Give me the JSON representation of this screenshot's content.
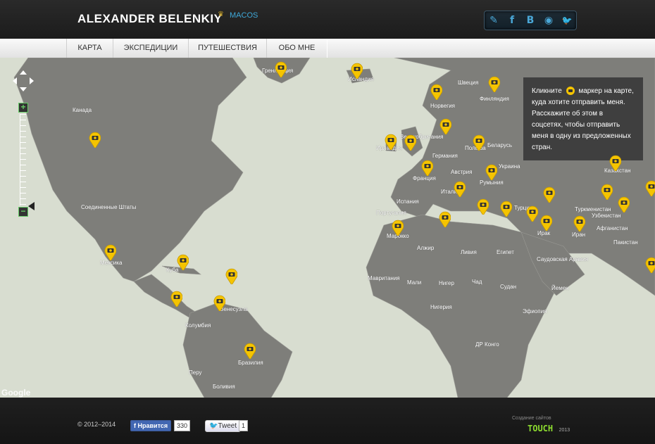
{
  "header": {
    "title": "ALEXANDER BELENKIY",
    "subtitle": "MACOS",
    "social": [
      "✎",
      "f",
      "B",
      "◉",
      "🐦"
    ]
  },
  "nav": {
    "items": [
      "КАРТА",
      "ЭКСПЕДИЦИИ",
      "ПУТЕШЕСТВИЯ",
      "ОБО МНЕ"
    ]
  },
  "map": {
    "info_text": "Кликните маркер на карте, куда хотите отправить меня. Расскажите об этом в соцсетях, чтобы отправить меня в одну из предложенных стран.",
    "info_before": "Кликните",
    "info_after": "маркер на карте, куда хотите отправить меня. Расскажите об этом в соцсетях, чтобы отправить меня в одну из предложенных стран.",
    "google": "Google",
    "labels": [
      "Гренландия",
      "Исландия",
      "Канада",
      "Швеция",
      "Финляндия",
      "Норвегия",
      "Ирландия",
      "Великобритания",
      "Польша",
      "Беларусь",
      "Германия",
      "Украина",
      "Франция",
      "Австрия",
      "Румыния",
      "Испания",
      "Италия",
      "Португалия",
      "Турция",
      "Казахстан",
      "Узбекистан",
      "Туркменистан",
      "Афганистан",
      "Пакистан",
      "Ирак",
      "Иран",
      "Марокко",
      "Алжир",
      "Ливия",
      "Египет",
      "Саудовская Аравия",
      "Мавритания",
      "Мали",
      "Нигер",
      "Чад",
      "Судан",
      "Йемен",
      "Эфиопия",
      "Нигерия",
      "ДР Конго",
      "Соединенные Штаты",
      "Мексика",
      "Куба",
      "Венесуэла",
      "Колумбия",
      "Перу",
      "Бразилия",
      "Боливия"
    ]
  },
  "footer": {
    "copyright": "© 2012–2014",
    "like_label": "Нравится",
    "like_count": "330",
    "tweet_label": "Tweet",
    "tweet_count": "1",
    "studio_caption": "Создание сайтов",
    "studio_name": "TOUCH",
    "studio_year": "2013"
  },
  "colors": {
    "accent": "#3fa9d9",
    "pin": "#f5c400",
    "land": "#7e7e7a",
    "water": "#d8ddd0"
  }
}
